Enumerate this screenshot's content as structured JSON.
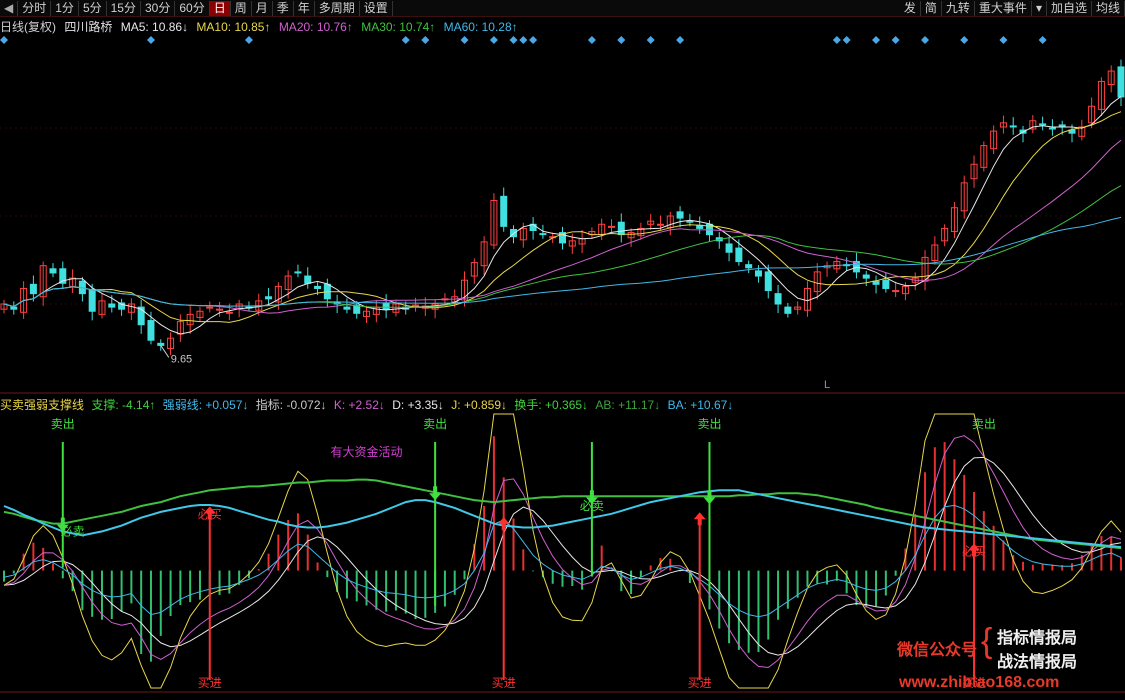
{
  "toolbar": {
    "left": [
      {
        "label": "分时",
        "active": false
      },
      {
        "label": "1分",
        "active": false
      },
      {
        "label": "5分",
        "active": false
      },
      {
        "label": "15分",
        "active": false
      },
      {
        "label": "30分",
        "active": false
      },
      {
        "label": "60分",
        "active": false
      },
      {
        "label": "日",
        "active": true
      },
      {
        "label": "周",
        "active": false
      },
      {
        "label": "月",
        "active": false
      },
      {
        "label": "季",
        "active": false
      },
      {
        "label": "年",
        "active": false
      },
      {
        "label": "多周期",
        "active": false
      },
      {
        "label": "设置",
        "active": false
      }
    ],
    "right": [
      "发",
      "简",
      "九转",
      "重大事件",
      "加自选",
      "均线"
    ]
  },
  "ma_header": {
    "period": "日线(复权)",
    "stock": "四川路桥",
    "items": [
      {
        "text": "MA5: 10.86↓",
        "color": "#e8e8e8"
      },
      {
        "text": "MA10: 10.85↑",
        "color": "#e8d64a"
      },
      {
        "text": "MA20: 10.76↑",
        "color": "#d060d0"
      },
      {
        "text": "MA30: 10.74↑",
        "color": "#40c040"
      },
      {
        "text": "MA60: 10.28↑",
        "color": "#40b8e8"
      }
    ]
  },
  "indicator_header": {
    "name": "买卖强弱支撑线",
    "items": [
      {
        "text": "支撑: -4.14↑",
        "color": "#40d040"
      },
      {
        "text": "强弱线: +0.057↓",
        "color": "#40b8e8"
      },
      {
        "text": "指标: -0.072↓",
        "color": "#c8c8c8"
      },
      {
        "text": "K: +2.52↓",
        "color": "#d060d0"
      },
      {
        "text": "D: +3.35↓",
        "color": "#e8e8e8"
      },
      {
        "text": "J: +0.859↓",
        "color": "#e8d64a"
      },
      {
        "text": "换手: +0.365↓",
        "color": "#40d040"
      },
      {
        "text": "AB: +11.17↓",
        "color": "#40a040"
      },
      {
        "text": "BA: +10.67↓",
        "color": "#40b8e8"
      }
    ]
  },
  "chart_data": {
    "type": "line",
    "bar_count": 115,
    "price_panel": {
      "close": [
        10.05,
        10.0,
        10.2,
        10.15,
        10.42,
        10.35,
        10.25,
        10.3,
        10.15,
        9.98,
        10.08,
        10.02,
        10.0,
        10.05,
        9.85,
        9.7,
        9.65,
        9.72,
        9.88,
        9.95,
        9.98,
        10.02,
        10.0,
        9.97,
        10.05,
        10.02,
        10.08,
        10.1,
        10.22,
        10.32,
        10.35,
        10.25,
        10.2,
        10.1,
        10.05,
        10.0,
        9.96,
        9.98,
        10.02,
        10.0,
        10.05,
        10.0,
        10.04,
        10.03,
        10.05,
        10.1,
        10.12,
        10.28,
        10.45,
        10.65,
        11.05,
        10.8,
        10.7,
        10.78,
        10.76,
        10.72,
        10.7,
        10.64,
        10.66,
        10.68,
        10.75,
        10.82,
        10.8,
        10.72,
        10.74,
        10.78,
        10.85,
        10.82,
        10.9,
        10.88,
        10.84,
        10.78,
        10.72,
        10.66,
        10.55,
        10.46,
        10.4,
        10.32,
        10.18,
        10.05,
        9.96,
        10.02,
        10.2,
        10.36,
        10.42,
        10.46,
        10.42,
        10.36,
        10.3,
        10.24,
        10.2,
        10.18,
        10.22,
        10.3,
        10.5,
        10.62,
        10.78,
        10.98,
        11.22,
        11.4,
        11.58,
        11.72,
        11.8,
        11.76,
        11.7,
        11.82,
        11.78,
        11.74,
        11.76,
        11.7,
        11.76,
        11.96,
        12.2,
        12.3,
        12.05
      ],
      "moving_averages": [
        {
          "name": "MA5",
          "period": 5,
          "color": "#e8e8e8"
        },
        {
          "name": "MA10",
          "period": 10,
          "color": "#e8d64a"
        },
        {
          "name": "MA20",
          "period": 20,
          "color": "#d060d0"
        },
        {
          "name": "MA30",
          "period": 30,
          "color": "#40c040"
        },
        {
          "name": "MA60",
          "period": 60,
          "color": "#40b8e8"
        }
      ],
      "ylim": [
        9.2,
        12.6
      ],
      "annotations": [
        {
          "text": "9.65",
          "bar": 16,
          "value": 9.65
        },
        {
          "text": "L",
          "bar": 84
        }
      ],
      "signal_marker_bars": [
        0,
        15,
        25,
        41,
        43,
        47,
        50,
        52,
        53,
        54,
        60,
        63,
        66,
        69,
        85,
        86,
        89,
        91,
        94,
        98,
        102,
        106
      ],
      "up_color": "#ff4040",
      "down_color": "#40e0e0",
      "grid": true
    },
    "indicator_panel": {
      "ylim": [
        -1.2,
        1.6
      ],
      "support_line": [
        0.6,
        0.58,
        0.55,
        0.52,
        0.5,
        0.48,
        0.48,
        0.5,
        0.52,
        0.54,
        0.56,
        0.58,
        0.6,
        0.63,
        0.66,
        0.68,
        0.7,
        0.73,
        0.76,
        0.78,
        0.8,
        0.82,
        0.83,
        0.84,
        0.85,
        0.86,
        0.86,
        0.87,
        0.88,
        0.89,
        0.9,
        0.9,
        0.91,
        0.92,
        0.92,
        0.92,
        0.93,
        0.93,
        0.92,
        0.9,
        0.88,
        0.86,
        0.84,
        0.82,
        0.8,
        0.78,
        0.76,
        0.74,
        0.72,
        0.71,
        0.7,
        0.71,
        0.72,
        0.73,
        0.74,
        0.75,
        0.75,
        0.76,
        0.76,
        0.76,
        0.76,
        0.76,
        0.76,
        0.76,
        0.76,
        0.76,
        0.76,
        0.76,
        0.76,
        0.76,
        0.76,
        0.76,
        0.76,
        0.76,
        0.76,
        0.77,
        0.77,
        0.78,
        0.78,
        0.79,
        0.79,
        0.79,
        0.78,
        0.77,
        0.75,
        0.73,
        0.71,
        0.69,
        0.67,
        0.64,
        0.62,
        0.6,
        0.58,
        0.56,
        0.54,
        0.52,
        0.5,
        0.48,
        0.46,
        0.44,
        0.42,
        0.4,
        0.38,
        0.36,
        0.34,
        0.32,
        0.31,
        0.3,
        0.29,
        0.28,
        0.27,
        0.26,
        0.25,
        0.24,
        0.23
      ],
      "strength_line": [
        0.66,
        0.62,
        0.57,
        0.53,
        0.48,
        0.44,
        0.4,
        0.38,
        0.36,
        0.38,
        0.4,
        0.43,
        0.46,
        0.5,
        0.54,
        0.57,
        0.6,
        0.62,
        0.64,
        0.66,
        0.67,
        0.67,
        0.66,
        0.64,
        0.61,
        0.58,
        0.55,
        0.52,
        0.5,
        0.47,
        0.45,
        0.44,
        0.44,
        0.45,
        0.47,
        0.49,
        0.52,
        0.55,
        0.58,
        0.62,
        0.66,
        0.7,
        0.72,
        0.72,
        0.7,
        0.67,
        0.64,
        0.6,
        0.56,
        0.52,
        0.48,
        0.46,
        0.45,
        0.44,
        0.44,
        0.45,
        0.46,
        0.48,
        0.5,
        0.52,
        0.54,
        0.56,
        0.58,
        0.61,
        0.64,
        0.67,
        0.7,
        0.72,
        0.74,
        0.76,
        0.78,
        0.8,
        0.81,
        0.82,
        0.82,
        0.82,
        0.8,
        0.78,
        0.76,
        0.74,
        0.72,
        0.7,
        0.68,
        0.66,
        0.64,
        0.62,
        0.6,
        0.58,
        0.56,
        0.54,
        0.52,
        0.5,
        0.48,
        0.46,
        0.44,
        0.43,
        0.42,
        0.41,
        0.4,
        0.39,
        0.38,
        0.37,
        0.36,
        0.35,
        0.34,
        0.33,
        0.32,
        0.31,
        0.3,
        0.29,
        0.28,
        0.27,
        0.26,
        0.25,
        0.24
      ],
      "index_line": [
        -0.15,
        -0.1,
        0.05,
        0.2,
        0.25,
        0.18,
        0.05,
        -0.1,
        -0.3,
        -0.45,
        -0.55,
        -0.6,
        -0.58,
        -0.52,
        -0.8,
        -1.0,
        -0.95,
        -0.8,
        -0.65,
        -0.55,
        -0.48,
        -0.42,
        -0.38,
        -0.35,
        -0.28,
        -0.2,
        -0.1,
        0.05,
        0.25,
        0.45,
        0.6,
        0.55,
        0.35,
        0.15,
        -0.05,
        -0.2,
        -0.3,
        -0.38,
        -0.45,
        -0.5,
        -0.52,
        -0.55,
        -0.6,
        -0.62,
        -0.6,
        -0.55,
        -0.45,
        -0.3,
        0.0,
        0.4,
        1.05,
        1.15,
        0.95,
        0.65,
        0.35,
        0.15,
        0.0,
        -0.1,
        -0.15,
        -0.2,
        -0.1,
        0.1,
        0.05,
        -0.1,
        -0.2,
        -0.15,
        -0.05,
        0.05,
        0.1,
        0.05,
        -0.05,
        -0.2,
        -0.35,
        -0.55,
        -0.75,
        -0.9,
        -1.0,
        -1.05,
        -1.0,
        -0.85,
        -0.7,
        -0.55,
        -0.4,
        -0.3,
        -0.25,
        -0.2,
        -0.25,
        -0.35,
        -0.42,
        -0.45,
        -0.4,
        -0.25,
        0.0,
        0.35,
        0.8,
        1.2,
        1.45,
        1.48,
        1.4,
        1.25,
        1.05,
        0.85,
        0.65,
        0.45,
        0.3,
        0.2,
        0.15,
        0.12,
        0.1,
        0.1,
        0.15,
        0.25,
        0.35,
        0.4,
        0.3
      ],
      "histogram_colors": {
        "up": "#e83030",
        "down": "#30c070",
        "accent": "#d040d0"
      },
      "labels": [
        {
          "text": "卖出",
          "bar": 6,
          "kind": "sell"
        },
        {
          "text": "卖出",
          "bar": 44,
          "kind": "sell"
        },
        {
          "text": "卖出",
          "bar": 72,
          "kind": "sell"
        },
        {
          "text": "卖出",
          "bar": 100,
          "kind": "sell"
        },
        {
          "text": "有大资金活动",
          "bar": 37,
          "kind": "fund"
        },
        {
          "text": "必卖",
          "bar": 7,
          "kind": "must_sell"
        },
        {
          "text": "必卖",
          "bar": 60,
          "kind": "must_sell"
        },
        {
          "text": "必买",
          "bar": 21,
          "kind": "must_buy"
        },
        {
          "text": "必买",
          "bar": 99,
          "kind": "must_buy"
        },
        {
          "text": "买进",
          "bar": 21,
          "kind": "buy"
        },
        {
          "text": "买进",
          "bar": 51,
          "kind": "buy"
        },
        {
          "text": "买进",
          "bar": 71,
          "kind": "buy"
        },
        {
          "text": "买进",
          "bar": 99,
          "kind": "buy"
        }
      ],
      "up_arrow_bars": [
        21,
        51,
        71,
        99
      ],
      "down_arrow_bars": [
        6,
        44,
        60,
        72
      ]
    }
  },
  "watermark": {
    "prefix": "微信公众号",
    "lines": [
      "指标情报局",
      "战法情报局"
    ],
    "url": "www.zhibiao168.com"
  }
}
